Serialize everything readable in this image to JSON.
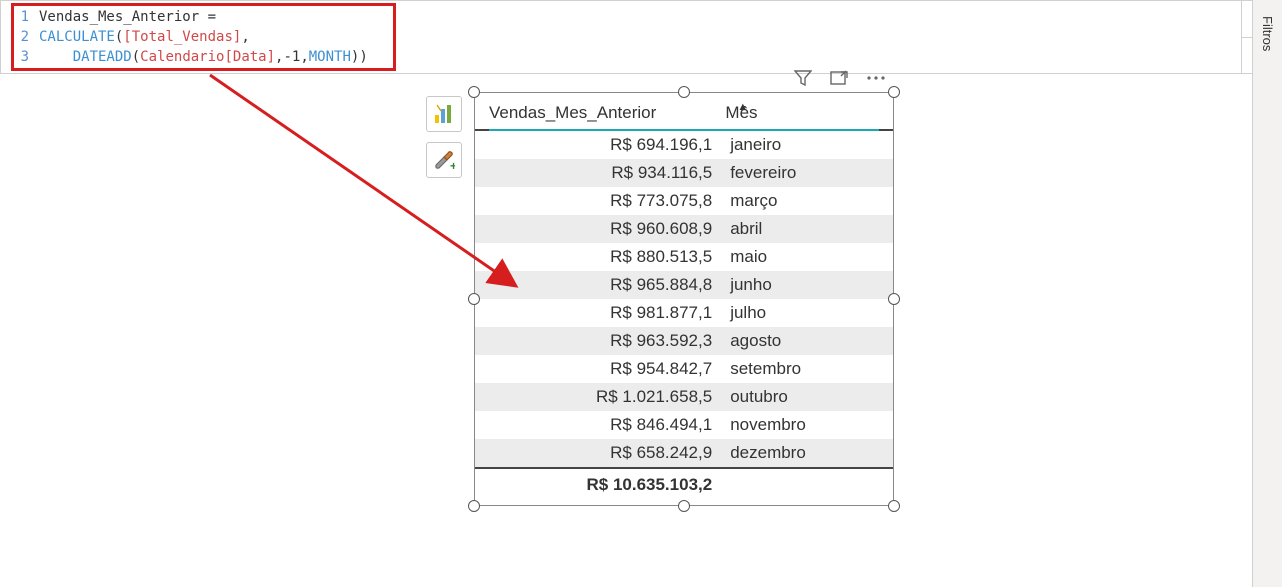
{
  "formula": {
    "lines": [
      {
        "num": "1",
        "tokens": [
          {
            "t": "Vendas_Mes_Anterior ",
            "cls": "plain"
          },
          {
            "t": "=",
            "cls": "plain"
          }
        ]
      },
      {
        "num": "2",
        "tokens": [
          {
            "t": "CALCULATE",
            "cls": "func"
          },
          {
            "t": "(",
            "cls": "plain"
          },
          {
            "t": "[Total_Vendas]",
            "cls": "ref"
          },
          {
            "t": ",",
            "cls": "plain"
          }
        ]
      },
      {
        "num": "3",
        "tokens": [
          {
            "t": "    ",
            "cls": "plain"
          },
          {
            "t": "DATEADD",
            "cls": "func"
          },
          {
            "t": "(",
            "cls": "plain"
          },
          {
            "t": "Calendario[Data]",
            "cls": "ref"
          },
          {
            "t": ",-1,",
            "cls": "plain"
          },
          {
            "t": "MONTH",
            "cls": "kw"
          },
          {
            "t": "))",
            "cls": "plain"
          }
        ]
      }
    ]
  },
  "panes": {
    "filters": "Filtros"
  },
  "table": {
    "headers": {
      "col1": "Vendas_Mes_Anterior",
      "col2": "Mês"
    },
    "rows": [
      {
        "value": "R$ 694.196,1",
        "month": "janeiro"
      },
      {
        "value": "R$ 934.116,5",
        "month": "fevereiro"
      },
      {
        "value": "R$ 773.075,8",
        "month": "março"
      },
      {
        "value": "R$ 960.608,9",
        "month": "abril"
      },
      {
        "value": "R$ 880.513,5",
        "month": "maio"
      },
      {
        "value": "R$ 965.884,8",
        "month": "junho"
      },
      {
        "value": "R$ 981.877,1",
        "month": "julho"
      },
      {
        "value": "R$ 963.592,3",
        "month": "agosto"
      },
      {
        "value": "R$ 954.842,7",
        "month": "setembro"
      },
      {
        "value": "R$ 1.021.658,5",
        "month": "outubro"
      },
      {
        "value": "R$ 846.494,1",
        "month": "novembro"
      },
      {
        "value": "R$ 658.242,9",
        "month": "dezembro"
      }
    ],
    "total": "R$ 10.635.103,2"
  }
}
